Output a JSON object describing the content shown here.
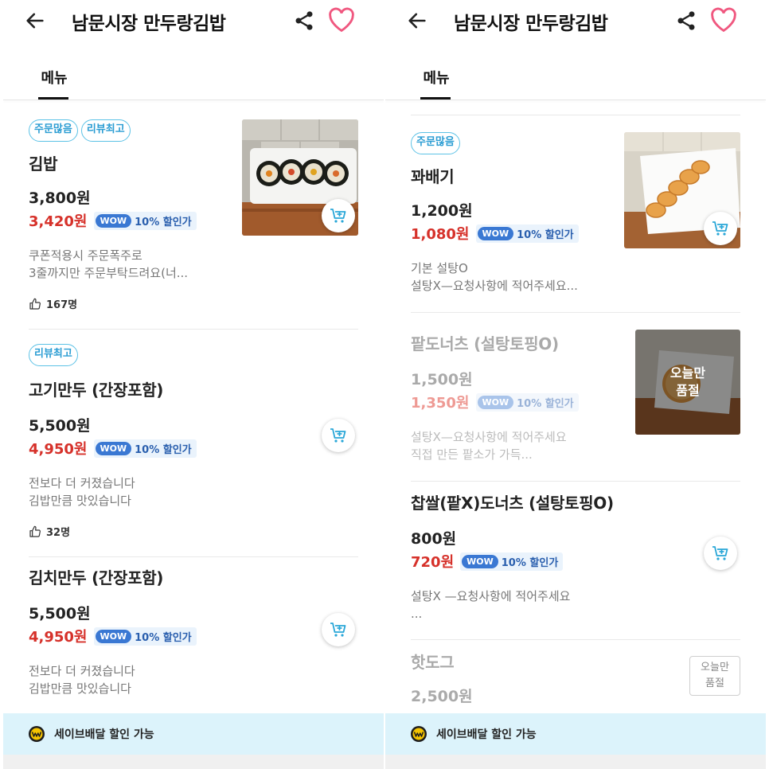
{
  "screens": [
    {
      "header": {
        "title": "남문시장 만두랑김밥"
      },
      "tabs": [
        {
          "label": "메뉴"
        }
      ],
      "items": [
        {
          "badges": [
            "주문많음",
            "리뷰최고"
          ],
          "name": "김밥",
          "price": "3,800원",
          "sale_price": "3,420원",
          "wow": "WOW",
          "discount": "10% 할인가",
          "desc": [
            "쿠폰적용시 주문폭주로",
            "3줄까지만 주문부탁드려요(너..."
          ],
          "likes": "167명"
        },
        {
          "badges": [
            "리뷰최고"
          ],
          "name": "고기만두 (간장포함)",
          "price": "5,500원",
          "sale_price": "4,950원",
          "wow": "WOW",
          "discount": "10% 할인가",
          "desc": [
            "전보다 더 커졌습니다",
            "김밥만큼 맛있습니다"
          ],
          "likes": "32명"
        },
        {
          "name": "김치만두 (간장포함)",
          "price": "5,500원",
          "sale_price": "4,950원",
          "wow": "WOW",
          "discount": "10% 할인가",
          "desc": [
            "전보다 더 커졌습니다",
            "김밥만큼 맛있습니다"
          ]
        }
      ],
      "footer": {
        "label": "세이브배달 할인 가능"
      }
    },
    {
      "header": {
        "title": "남문시장 만두랑김밥"
      },
      "tabs": [
        {
          "label": "메뉴"
        }
      ],
      "items": [
        {
          "badges": [
            "주문많음"
          ],
          "name": "꽈배기",
          "price": "1,200원",
          "sale_price": "1,080원",
          "wow": "WOW",
          "discount": "10% 할인가",
          "desc": [
            "기본 설탕O",
            "설탕X—요청사항에 적어주세요..."
          ]
        },
        {
          "name": "팥도너츠 (설탕토핑O)",
          "price": "1,500원",
          "sale_price": "1,350원",
          "wow": "WOW",
          "discount": "10% 할인가",
          "desc": [
            "설탕X—요청사항에 적어주세요",
            "직접 만든 팥소가 가득..."
          ],
          "soldout": [
            "오늘만",
            "품절"
          ]
        },
        {
          "name": "찹쌀(팥X)도너츠  (설탕토핑O)",
          "price": "800원",
          "sale_price": "720원",
          "wow": "WOW",
          "discount": "10% 할인가",
          "desc": [
            "설탕X —요청사항에 적어주세요",
            "..."
          ]
        },
        {
          "name": "핫도그",
          "price": "2,500원",
          "soldout": [
            "오늘만",
            "품절"
          ]
        }
      ],
      "footer": {
        "label": "세이브배달 할인 가능"
      }
    }
  ],
  "colors": {
    "sale": "#d6312a",
    "wow": "#3a78d3",
    "badge": "#2b9dd3",
    "heart": "#f0577f",
    "footer_bg": "#dcf3fb"
  },
  "icons": [
    "back-arrow-icon",
    "share-icon",
    "heart-icon",
    "cart-add-icon",
    "thumbs-up-icon",
    "safe-delivery-icon"
  ]
}
